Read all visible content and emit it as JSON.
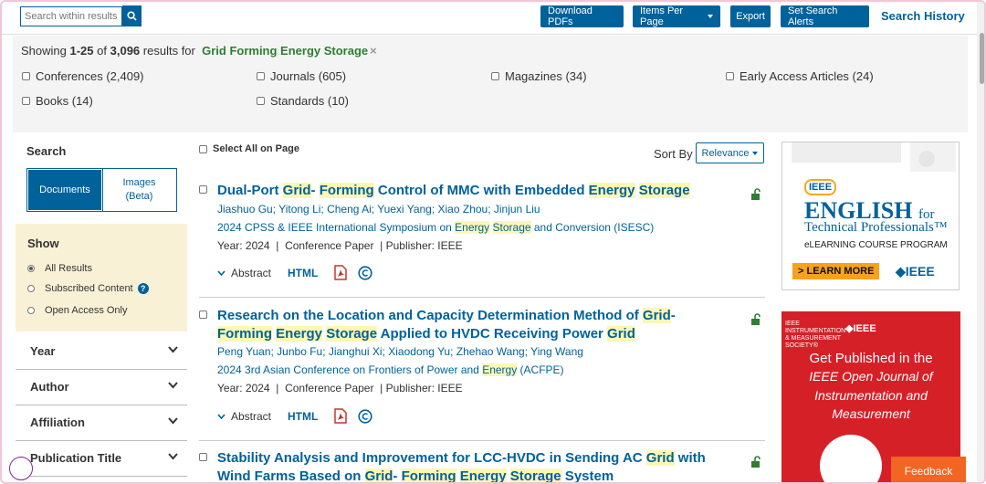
{
  "topbar": {
    "search_placeholder": "Search within results",
    "buttons": {
      "download": "Download PDFs",
      "items_per_page": "Items Per Page",
      "export": "Export",
      "alerts": "Set Search Alerts"
    },
    "history": "Search History"
  },
  "summary": {
    "showing": "Showing",
    "range": "1-25",
    "of": "of",
    "total": "3,096",
    "results_for": "results for",
    "term": "Grid Forming Energy Storage",
    "remove": "×",
    "filters": [
      "Conferences (2,409)",
      "Journals (605)",
      "Magazines (34)",
      "Early Access Articles (24)",
      "Books (14)",
      "Standards (10)"
    ]
  },
  "sidebar": {
    "search_title": "Search",
    "documents": "Documents",
    "images_1": "Images",
    "images_2": "(Beta)",
    "show_title": "Show",
    "show_options": [
      "All Results",
      "Subscribed Content",
      "Open Access Only"
    ],
    "help": "?",
    "facets": [
      "Year",
      "Author",
      "Affiliation",
      "Publication Title"
    ]
  },
  "results_header": {
    "select_all": "Select All on Page",
    "sort_by": "Sort By",
    "relevance": "Relevance"
  },
  "results": [
    {
      "title_parts": [
        "Dual-Port ",
        "Grid",
        "- ",
        "Forming",
        " Control of MMC with Embedded ",
        "Energy",
        " ",
        "Storage"
      ],
      "authors": "Jiashuo Gu; Yitong Li; Cheng Ai; Yuexi Yang; Xiao Zhou; Jinjun Liu",
      "venue_parts": [
        "2024 CPSS & IEEE International Symposium on ",
        "Energy",
        " ",
        "Storage",
        " and Conversion (ISESC)"
      ],
      "year": "Year: 2024",
      "type": "Conference Paper",
      "publisher": "Publisher:  IEEE",
      "abstract": "Abstract",
      "html": "HTML"
    },
    {
      "title_parts": [
        "Research on the Location and Capacity Determination Method of ",
        "Grid",
        "- ",
        "Forming",
        " ",
        "Energy",
        " ",
        "Storage",
        " Applied to HVDC Receiving Power ",
        "Grid"
      ],
      "authors": "Peng Yuan; Junbo Fu; Jianghui Xi; Xiaodong Yu; Zhehao Wang; Ying Wang",
      "venue_parts": [
        "2024 3rd Asian Conference on Frontiers of Power and ",
        "Energy",
        " (ACFPE)"
      ],
      "year": "Year: 2024",
      "type": "Conference Paper",
      "publisher": "Publisher:  IEEE",
      "abstract": "Abstract",
      "html": "HTML"
    },
    {
      "title_parts": [
        "Stability Analysis and Improvement for LCC-HVDC in Sending AC ",
        "Grid",
        " with Wind Farms Based on ",
        "Grid",
        "- ",
        "Forming",
        " ",
        "Energy",
        " ",
        "Storage",
        " System"
      ]
    }
  ],
  "ads": {
    "ad1": {
      "ieee": "IEEE",
      "english": "ENGLISH",
      "for": "for",
      "tech": "Technical Professionals™",
      "course": "eLEARNING COURSE PROGRAM",
      "learn": "> LEARN MORE",
      "logo": "◆IEEE"
    },
    "ad2": {
      "society_1": "IEEE",
      "society_2": "INSTRUMENTATION",
      "society_3": "& MEASUREMENT",
      "society_4": "SOCIETY®",
      "ieee": "◆IEEE",
      "get": "Get Published in the",
      "line1": "IEEE Open Journal of",
      "line2": "Instrumentation and",
      "line3": "Measurement"
    }
  },
  "feedback": "Feedback",
  "colors": {
    "accent": "#00629b",
    "highlight": "#fdf7b2",
    "feedback": "#f26522"
  }
}
